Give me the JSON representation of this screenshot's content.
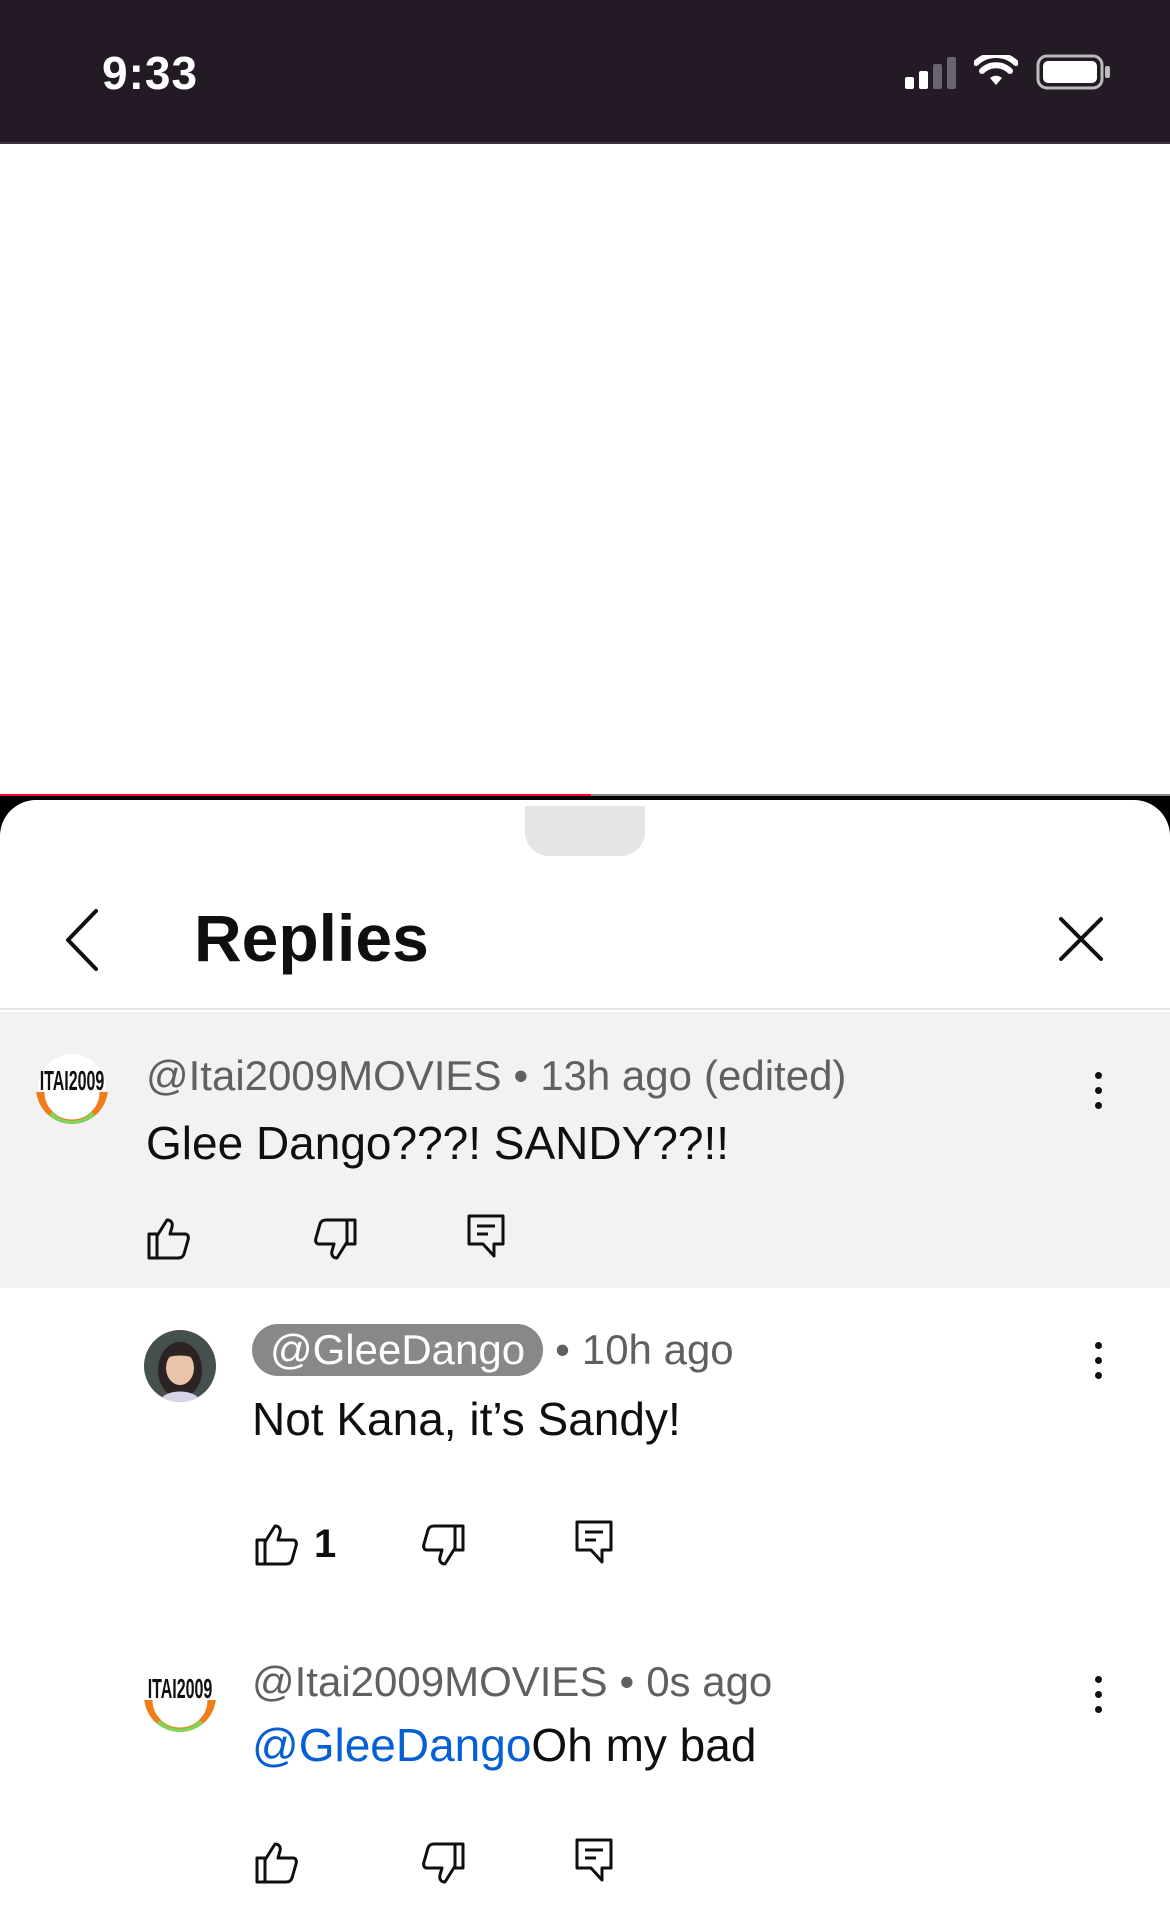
{
  "status_bar": {
    "time": "9:33"
  },
  "video": {
    "progress_fraction": 0.505
  },
  "sheet": {
    "title": "Replies"
  },
  "comments": [
    {
      "author": "@Itai2009MOVIES",
      "age": "13h ago",
      "edited": "(edited)",
      "text": "Glee Dango???! SANDY??!!",
      "likes": "",
      "avatar": "ITAI2009"
    },
    {
      "author": "@GleeDango",
      "age": "10h ago",
      "edited": "",
      "text": "Not Kana, it’s Sandy!",
      "likes": "1",
      "avatar": "girl-portrait"
    },
    {
      "author": "@Itai2009MOVIES",
      "age": "0s ago",
      "edited": "",
      "mention": "@GleeDango",
      "text": "Oh my bad",
      "likes": "",
      "avatar": "ITAI2009"
    }
  ],
  "icons": {
    "like": "thumb-up-icon",
    "dislike": "thumb-down-icon",
    "reply": "reply-icon",
    "more": "more-vert-icon",
    "back": "chevron-left-icon",
    "close": "close-icon"
  },
  "colors": {
    "mention": "#065fd4",
    "progress": "#ff0033",
    "status_bg": "#231a26"
  }
}
